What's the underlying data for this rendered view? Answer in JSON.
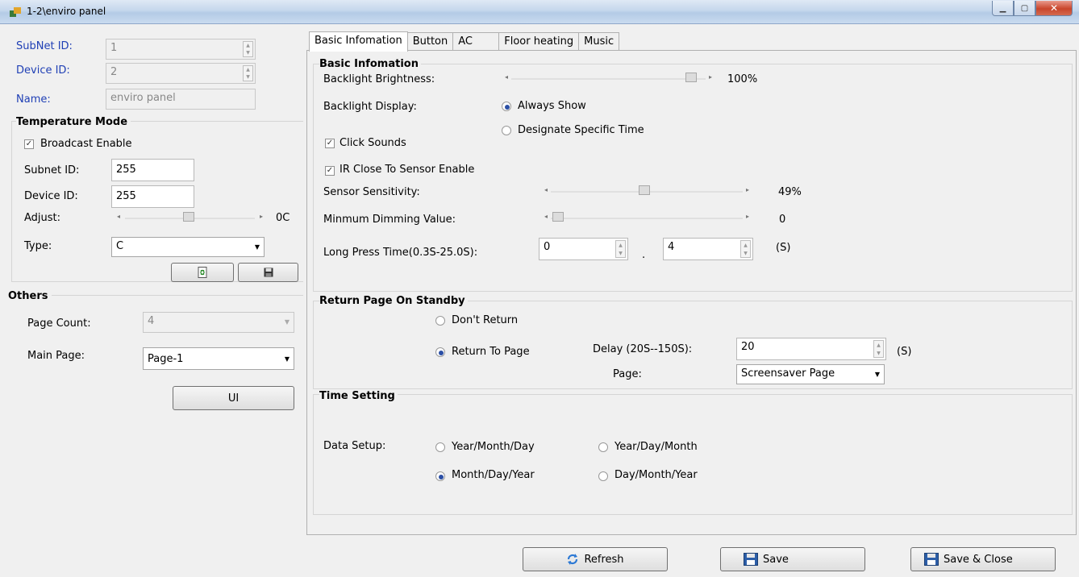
{
  "window": {
    "title": "1-2\\enviro panel"
  },
  "left": {
    "subnet_label": "SubNet ID:",
    "subnet_value": "1",
    "device_label": "Device ID:",
    "device_value": "2",
    "name_label": "Name:",
    "name_value": "enviro panel",
    "temp_mode": {
      "title": "Temperature Mode",
      "broadcast_label": "Broadcast Enable",
      "broadcast_checked": true,
      "subnet_label": "Subnet ID:",
      "subnet_value": "255",
      "device_label": "Device ID:",
      "device_value": "255",
      "adjust_label": "Adjust:",
      "adjust_value": "0C",
      "type_label": "Type:",
      "type_value": "C"
    },
    "others": {
      "title": "Others",
      "page_count_label": "Page Count:",
      "page_count_value": "4",
      "main_page_label": "Main Page:",
      "main_page_value": "Page-1",
      "ui_button": "UI"
    }
  },
  "tabs": [
    {
      "label": "Basic Infomation",
      "active": true
    },
    {
      "label": "Button",
      "active": false
    },
    {
      "label": "AC",
      "active": false
    },
    {
      "label": "Floor heating",
      "active": false
    },
    {
      "label": "Music",
      "active": false
    }
  ],
  "basic": {
    "title": "Basic Infomation",
    "backlight_brightness_label": "Backlight Brightness:",
    "backlight_brightness_value": "100%",
    "backlight_display_label": "Backlight Display:",
    "always_show": "Always Show",
    "designate_time": "Designate Specific Time",
    "click_sounds": "Click Sounds",
    "ir_close": "IR Close To Sensor Enable",
    "sensor_sensitivity_label": "Sensor Sensitivity:",
    "sensor_sensitivity_value": "49%",
    "min_dimming_label": "Minmum Dimming Value:",
    "min_dimming_value": "0",
    "long_press_label": "Long Press Time(0.3S-25.0S):",
    "long_press_int": "0",
    "long_press_dot": ".",
    "long_press_frac": "4",
    "long_press_unit": "(S)"
  },
  "standby": {
    "title": "Return Page On Standby",
    "dont_return": "Don't Return",
    "return_to_page": "Return To  Page",
    "delay_label": "Delay (20S--150S):",
    "delay_value": "20",
    "delay_unit": "(S)",
    "page_label": "Page:",
    "page_value": "Screensaver Page"
  },
  "time": {
    "title": "Time Setting",
    "data_setup_label": "Data Setup:",
    "ymd": "Year/Month/Day",
    "ydm": "Year/Day/Month",
    "mdy": "Month/Day/Year",
    "dmy": "Day/Month/Year"
  },
  "footer": {
    "refresh": "Refresh",
    "save": "Save",
    "save_close": "Save & Close"
  },
  "colors": {
    "label_blue": "#1f3fb5",
    "radio_dot": "#2b4fa5"
  }
}
